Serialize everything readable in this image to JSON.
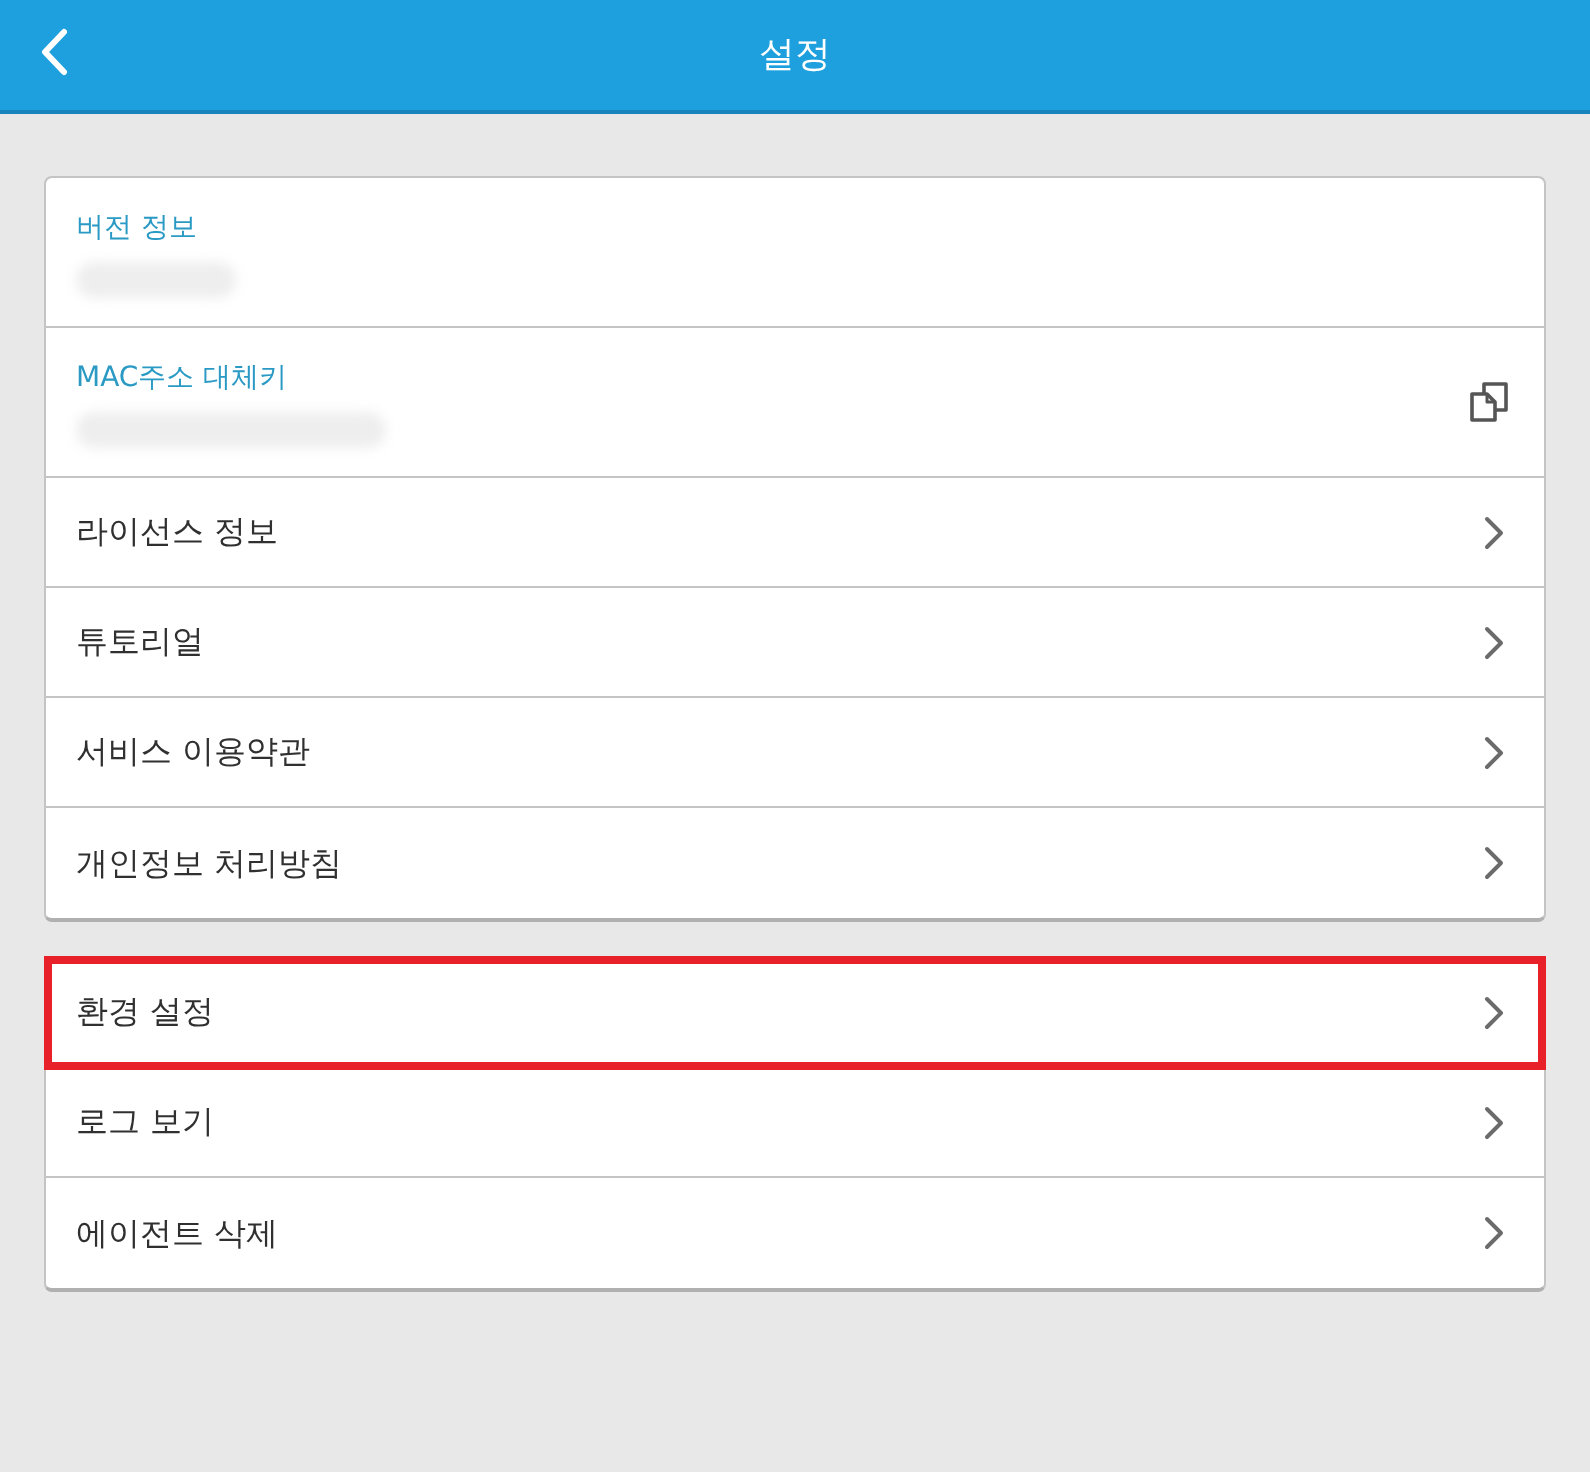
{
  "header": {
    "title": "설정"
  },
  "groups": [
    {
      "rows": [
        {
          "kind": "info",
          "label": "버전 정보",
          "value_hidden": true,
          "copyable": false
        },
        {
          "kind": "info",
          "label": "MAC주소 대체키",
          "value_hidden": true,
          "copyable": true
        },
        {
          "kind": "link",
          "label": "라이선스 정보",
          "highlighted": false
        },
        {
          "kind": "link",
          "label": "튜토리얼",
          "highlighted": false
        },
        {
          "kind": "link",
          "label": "서비스 이용약관",
          "highlighted": false
        },
        {
          "kind": "link",
          "label": "개인정보 처리방침",
          "highlighted": false
        }
      ]
    },
    {
      "rows": [
        {
          "kind": "link",
          "label": "환경 설정",
          "highlighted": true
        },
        {
          "kind": "link",
          "label": "로그 보기",
          "highlighted": false
        },
        {
          "kind": "link",
          "label": "에이전트 삭제",
          "highlighted": false
        }
      ]
    }
  ]
}
